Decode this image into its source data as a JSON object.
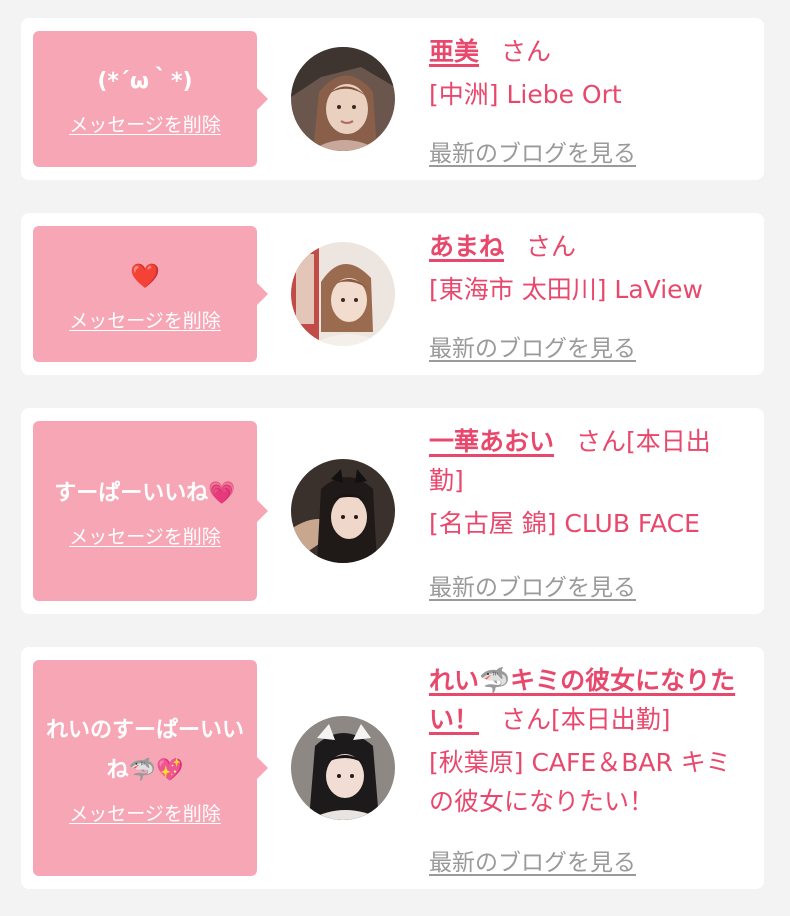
{
  "cards": [
    {
      "message": "(*´ω｀*)",
      "delete_label": "メッセージを削除",
      "name": "亜美",
      "san": "さん",
      "shop": "[中洲] Liebe Ort",
      "blog_label": "最新のブログを見る",
      "avatar_icon": "profile-photo"
    },
    {
      "message": "❤️",
      "delete_label": "メッセージを削除",
      "name": "あまね",
      "san": "さん",
      "shop": "[東海市 太田川] LaView",
      "blog_label": "最新のブログを見る",
      "avatar_icon": "profile-photo"
    },
    {
      "message": "すーぱーいいね💗",
      "delete_label": "メッセージを削除",
      "name": "一華あおい",
      "san": "さん[本日出勤]",
      "shop": "[名古屋 錦] CLUB FACE",
      "blog_label": "最新のブログを見る",
      "avatar_icon": "profile-photo"
    },
    {
      "message": "れいのすーぱーいいね🦈💖",
      "delete_label": "メッセージを削除",
      "name": "れい🦈キミの彼女になりたい！",
      "san": "さん[本日出勤]",
      "shop": "[秋葉原] CAFE＆BAR キミの彼女になりたい！",
      "blog_label": "最新のブログを見る",
      "avatar_icon": "profile-photo"
    }
  ],
  "colors": {
    "accent": "#e9486d",
    "bubble": "#f7a6b5",
    "link_gray": "#9a9a9a",
    "background": "#f3f3f3"
  }
}
